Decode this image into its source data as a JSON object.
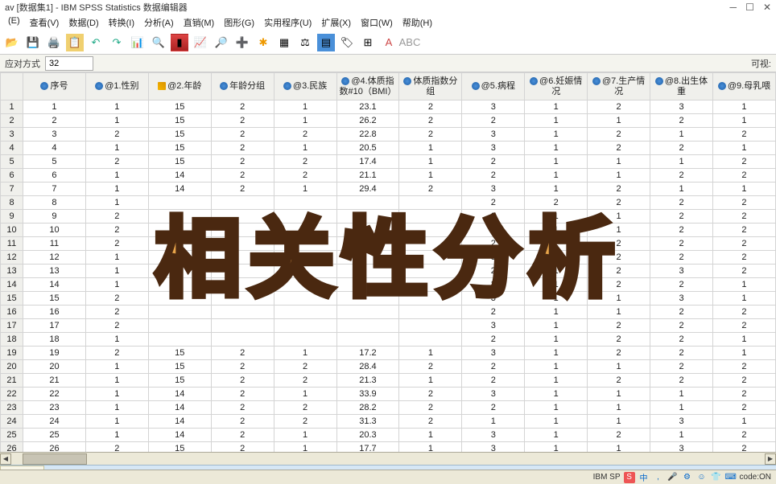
{
  "title": "av [数据集1] - IBM SPSS Statistics 数据编辑器",
  "menu": [
    "(E)",
    "查看(V)",
    "数据(D)",
    "转换(I)",
    "分析(A)",
    "直销(M)",
    "图形(G)",
    "实用程序(U)",
    "扩展(X)",
    "窗口(W)",
    "帮助(H)"
  ],
  "cellRef": {
    "label": "应对方式",
    "value": "32",
    "right": "可视:"
  },
  "columns": [
    {
      "label": "序号",
      "icon": "nom"
    },
    {
      "label": "@1.性别",
      "icon": "nom"
    },
    {
      "label": "@2.年龄",
      "icon": "scale"
    },
    {
      "label": "年龄分组",
      "icon": "nom"
    },
    {
      "label": "@3.民族",
      "icon": "nom"
    },
    {
      "label": "@4.体质指数#10（BMI）",
      "icon": "nom"
    },
    {
      "label": "体质指数分组",
      "icon": "nom"
    },
    {
      "label": "@5.病程",
      "icon": "nom"
    },
    {
      "label": "@6.妊娠情况",
      "icon": "nom"
    },
    {
      "label": "@7.生产情况",
      "icon": "nom"
    },
    {
      "label": "@8.出生体重",
      "icon": "nom"
    },
    {
      "label": "@9.母乳喂",
      "icon": "nom"
    }
  ],
  "rows": [
    [
      1,
      1,
      15,
      2,
      1,
      23.1,
      2,
      3,
      1,
      2,
      3,
      1
    ],
    [
      2,
      1,
      15,
      2,
      1,
      26.2,
      2,
      2,
      1,
      1,
      2,
      1
    ],
    [
      3,
      2,
      15,
      2,
      2,
      22.8,
      2,
      3,
      1,
      2,
      1,
      2
    ],
    [
      4,
      1,
      15,
      2,
      1,
      20.5,
      1,
      3,
      1,
      2,
      2,
      1
    ],
    [
      5,
      2,
      15,
      2,
      2,
      17.4,
      1,
      2,
      1,
      1,
      1,
      2
    ],
    [
      6,
      1,
      14,
      2,
      2,
      21.1,
      1,
      2,
      1,
      1,
      2,
      2
    ],
    [
      7,
      1,
      14,
      2,
      1,
      29.4,
      2,
      3,
      1,
      2,
      1,
      1
    ],
    [
      8,
      1,
      "",
      "",
      "",
      "",
      "",
      2,
      2,
      2,
      2,
      2
    ],
    [
      9,
      2,
      "",
      "",
      "",
      "",
      "",
      2,
      1,
      1,
      2,
      2
    ],
    [
      10,
      2,
      "",
      "",
      "",
      "",
      "",
      2,
      1,
      1,
      2,
      2
    ],
    [
      11,
      2,
      "",
      "",
      "",
      "",
      "",
      2,
      1,
      2,
      2,
      2
    ],
    [
      12,
      1,
      "",
      "",
      "",
      "",
      "",
      3,
      1,
      2,
      2,
      2
    ],
    [
      13,
      1,
      "",
      "",
      "",
      "",
      "",
      2,
      1,
      2,
      3,
      2
    ],
    [
      14,
      1,
      "",
      "",
      "",
      "",
      "",
      2,
      1,
      2,
      2,
      1
    ],
    [
      15,
      2,
      "",
      "",
      "",
      "",
      "",
      3,
      1,
      1,
      3,
      1
    ],
    [
      16,
      2,
      "",
      "",
      "",
      "",
      "",
      2,
      1,
      1,
      2,
      2
    ],
    [
      17,
      2,
      "",
      "",
      "",
      "",
      "",
      3,
      1,
      2,
      2,
      2
    ],
    [
      18,
      1,
      "",
      "",
      "",
      "",
      "",
      2,
      1,
      2,
      2,
      1
    ],
    [
      19,
      2,
      15,
      2,
      1,
      17.2,
      1,
      3,
      1,
      2,
      2,
      1
    ],
    [
      20,
      1,
      15,
      2,
      2,
      28.4,
      2,
      2,
      1,
      1,
      2,
      2
    ],
    [
      21,
      1,
      15,
      2,
      2,
      21.3,
      1,
      2,
      1,
      2,
      2,
      2
    ],
    [
      22,
      1,
      14,
      2,
      1,
      33.9,
      2,
      3,
      1,
      1,
      1,
      2
    ],
    [
      23,
      1,
      14,
      2,
      2,
      28.2,
      2,
      2,
      1,
      1,
      1,
      2
    ],
    [
      24,
      1,
      14,
      2,
      2,
      31.3,
      2,
      1,
      1,
      1,
      3,
      1
    ],
    [
      25,
      1,
      14,
      2,
      1,
      20.3,
      1,
      3,
      1,
      2,
      1,
      2
    ],
    [
      26,
      2,
      15,
      2,
      1,
      17.7,
      1,
      3,
      1,
      1,
      3,
      2
    ]
  ],
  "tab": "量视图",
  "overlay": "相关性分析",
  "status": {
    "brand": "IBM SP",
    "ime": "S",
    "lang": "中",
    "code": "code:ON"
  }
}
